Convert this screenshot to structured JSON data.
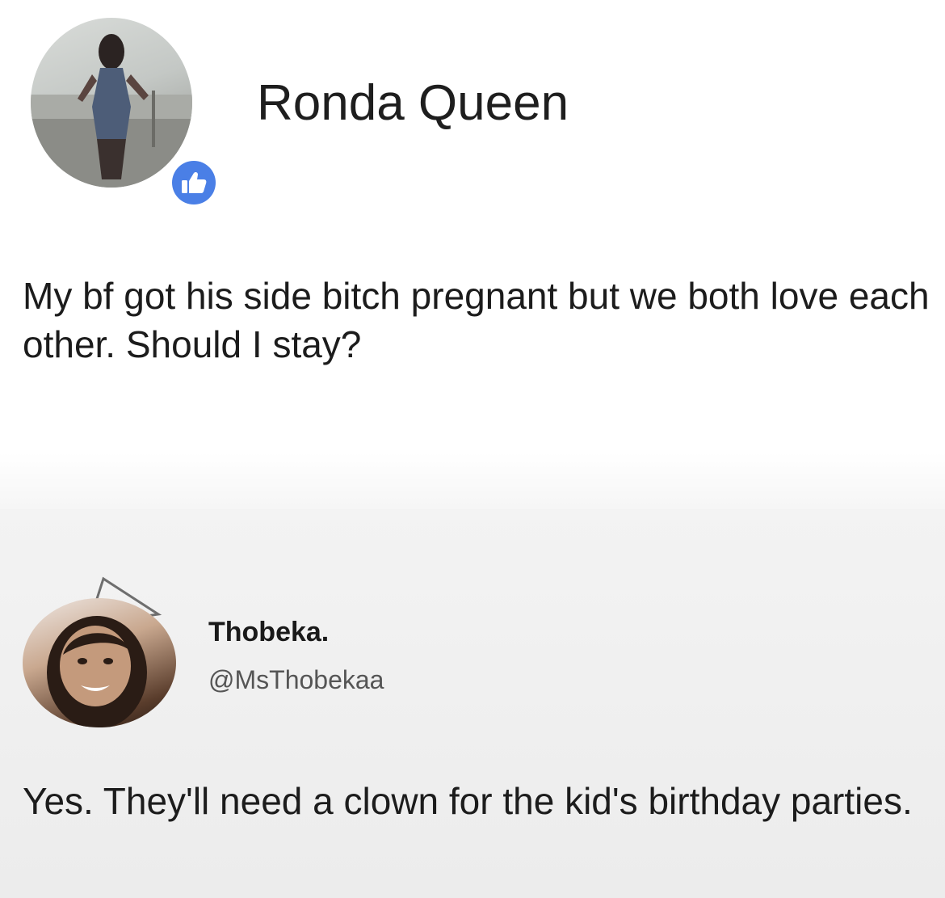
{
  "post": {
    "author_name": "Ronda Queen",
    "badge_icon": "thumbs-up-icon",
    "badge_color": "#4a7fe6",
    "text": "My bf got his side bitch pregnant but we both love each other. Should I stay?"
  },
  "reply": {
    "author_name": "Thobeka.",
    "handle": "@MsThobekaa",
    "text": "Yes. They'll need a clown for the kid's birthday parties."
  }
}
